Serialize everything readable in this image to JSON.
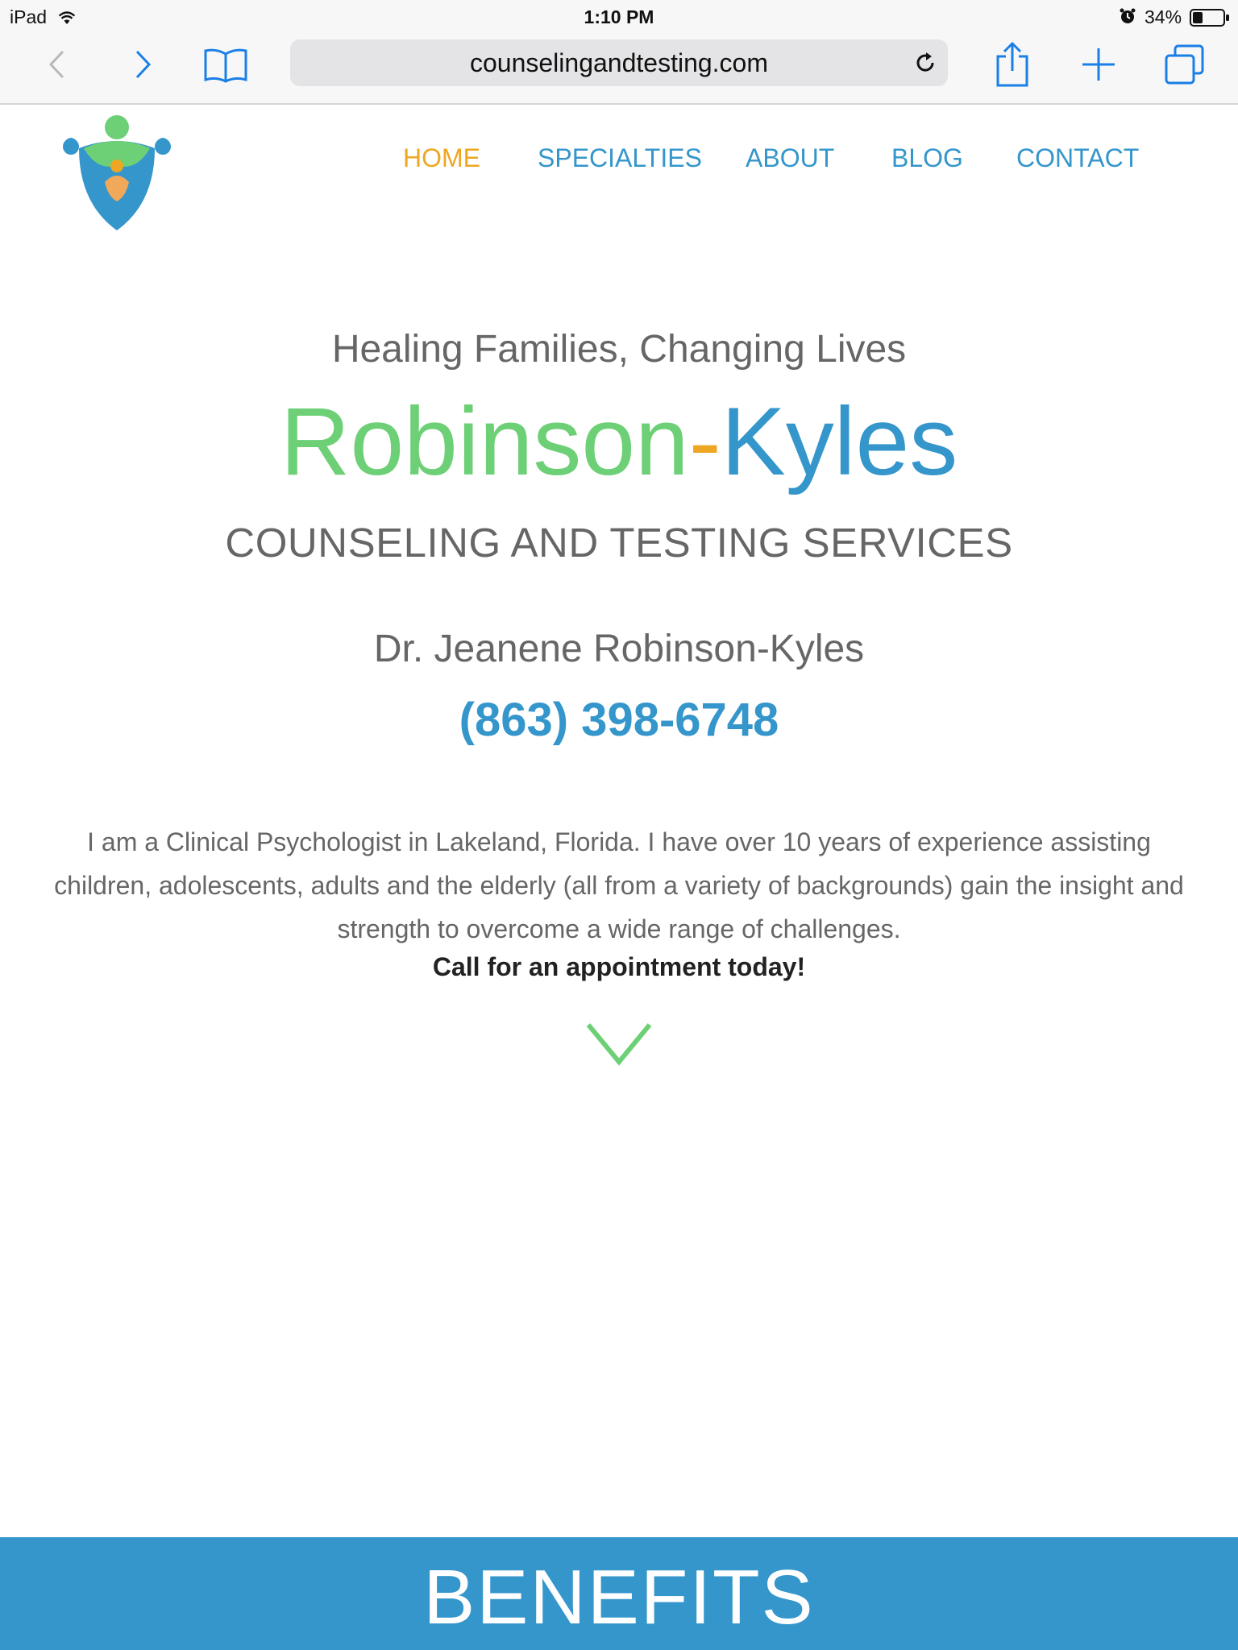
{
  "status_bar": {
    "device": "iPad",
    "time": "1:10 PM",
    "battery": "34%",
    "battery_level": 0.34
  },
  "browser": {
    "url": "counselingandtesting.com"
  },
  "nav": {
    "items": [
      {
        "label": "HOME",
        "active": true
      },
      {
        "label": "SPECIALTIES",
        "active": false
      },
      {
        "label": "ABOUT",
        "active": false
      },
      {
        "label": "BLOG",
        "active": false
      },
      {
        "label": "CONTACT",
        "active": false
      }
    ]
  },
  "hero": {
    "tagline": "Healing Families, Changing Lives",
    "brand_part1": "Robinson",
    "brand_dash": "-",
    "brand_part2": "Kyles",
    "services": "COUNSELING AND TESTING SERVICES",
    "doctor": "Dr. Jeanene Robinson-Kyles",
    "phone": "(863) 398-6748",
    "description": "I am a Clinical Psychologist in Lakeland, Florida. I have over 10 years of experience assisting children, adolescents, adults and the elderly (all from a variety of backgrounds) gain the insight and strength to overcome a wide range of challenges.",
    "cta": "Call for an appointment today!"
  },
  "benefits": {
    "title": "BENEFITS"
  },
  "colors": {
    "blue": "#3496cb",
    "green": "#6dd076",
    "orange": "#eea723",
    "gray_text": "#666666"
  }
}
